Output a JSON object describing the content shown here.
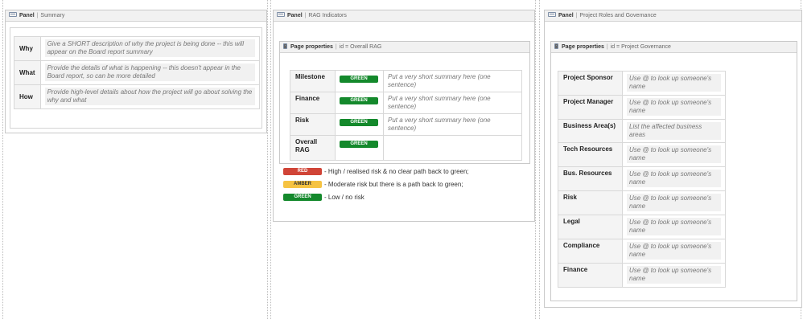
{
  "summary_panel": {
    "title": "Panel",
    "subtitle": "Summary",
    "rows": [
      {
        "key": "Why",
        "value": "Give a SHORT description of why the project is being done -- this will appear on the Board report summary"
      },
      {
        "key": "What",
        "value": "Provide the details of what is happening -- this doesn't appear in the Board report, so can be more detailed"
      },
      {
        "key": "How",
        "value": "Provide high-level details about how the project will go about solving the why and what"
      }
    ]
  },
  "rag_panel": {
    "title": "Panel",
    "subtitle": "RAG Indicators",
    "page_properties": {
      "label": "Page properties",
      "id": "id = Overall RAG"
    },
    "rows": [
      {
        "key": "Milestone",
        "status": "GREEN",
        "summary": "Put a very short summary here (one sentence)"
      },
      {
        "key": "Finance",
        "status": "GREEN",
        "summary": "Put a very short summary here (one sentence)"
      },
      {
        "key": "Risk",
        "status": "GREEN",
        "summary": "Put a very short summary here (one sentence)"
      },
      {
        "key": "Overall RAG",
        "status": "GREEN",
        "summary": ""
      }
    ],
    "legend": [
      {
        "status": "RED",
        "color": "#d04437",
        "text": "- High / realised risk & no clear path back to green;"
      },
      {
        "status": "AMBER",
        "color": "#f6c342",
        "text": "- Moderate risk but there is a path back to green;"
      },
      {
        "status": "GREEN",
        "color": "#14892c",
        "text": "- Low / no risk"
      }
    ],
    "status_colors": {
      "GREEN": "#14892c",
      "RED": "#d04437",
      "AMBER": "#f6c342"
    }
  },
  "governance_panel": {
    "title": "Panel",
    "subtitle": "Project Roles and Governance",
    "page_properties": {
      "label": "Page properties",
      "id": "id = Project Governance"
    },
    "rows": [
      {
        "key": "Project Sponsor",
        "value": "Use @ to look up someone's name"
      },
      {
        "key": "Project Manager",
        "value": "Use @ to look up someone's name"
      },
      {
        "key": "Business Area(s)",
        "value": "List the affected business areas"
      },
      {
        "key": "Tech Resources",
        "value": "Use @ to look up someone's name"
      },
      {
        "key": "Bus. Resources",
        "value": "Use @ to look up someone's name"
      },
      {
        "key": "Risk",
        "value": "Use @ to look up someone's name"
      },
      {
        "key": "Legal",
        "value": "Use @ to look up someone's name"
      },
      {
        "key": "Compliance",
        "value": "Use @ to look up someone's name"
      },
      {
        "key": "Finance",
        "value": "Use @ to look up someone's name"
      }
    ]
  }
}
